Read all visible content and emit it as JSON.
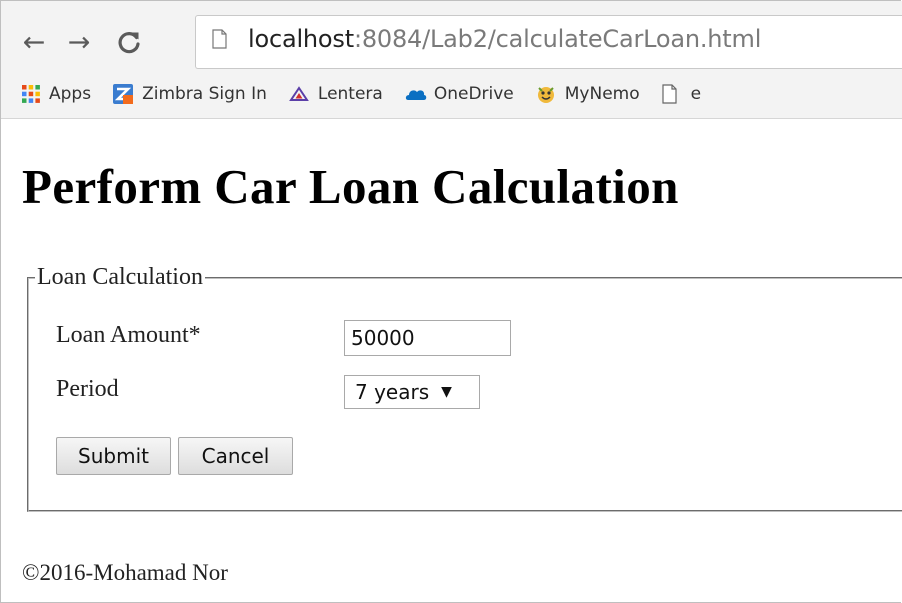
{
  "browser": {
    "url_host": "localhost",
    "url_rest": ":8084/Lab2/calculateCarLoan.html",
    "nav": {
      "back_icon": "arrow-left-icon",
      "forward_icon": "arrow-right-icon",
      "reload_icon": "reload-icon"
    },
    "bookmarks": [
      {
        "label": "Apps",
        "icon": "apps-grid-icon"
      },
      {
        "label": "Zimbra Sign In",
        "icon": "zimbra-icon"
      },
      {
        "label": "Lentera",
        "icon": "lentera-icon"
      },
      {
        "label": "OneDrive",
        "icon": "onedrive-icon"
      },
      {
        "label": "MyNemo",
        "icon": "mynemo-icon"
      },
      {
        "label": "e",
        "icon": "page-icon"
      }
    ]
  },
  "page": {
    "title": "Perform Car Loan Calculation",
    "form": {
      "legend": "Loan Calculation",
      "loan_amount_label": "Loan Amount*",
      "loan_amount_value": "50000",
      "period_label": "Period",
      "period_selected": "7 years",
      "submit_label": "Submit",
      "cancel_label": "Cancel"
    },
    "footer": "©2016-Mohamad Nor"
  },
  "colors": {
    "toolbar_bg": "#f3f3f3",
    "url_host": "#222222",
    "url_rest": "#7a7a7a",
    "apps_grid": [
      "#e64a19",
      "#fbbc05",
      "#34a853",
      "#4285f4"
    ],
    "onedrive": "#0a6fc2",
    "lentera": "#5b3fa8"
  }
}
